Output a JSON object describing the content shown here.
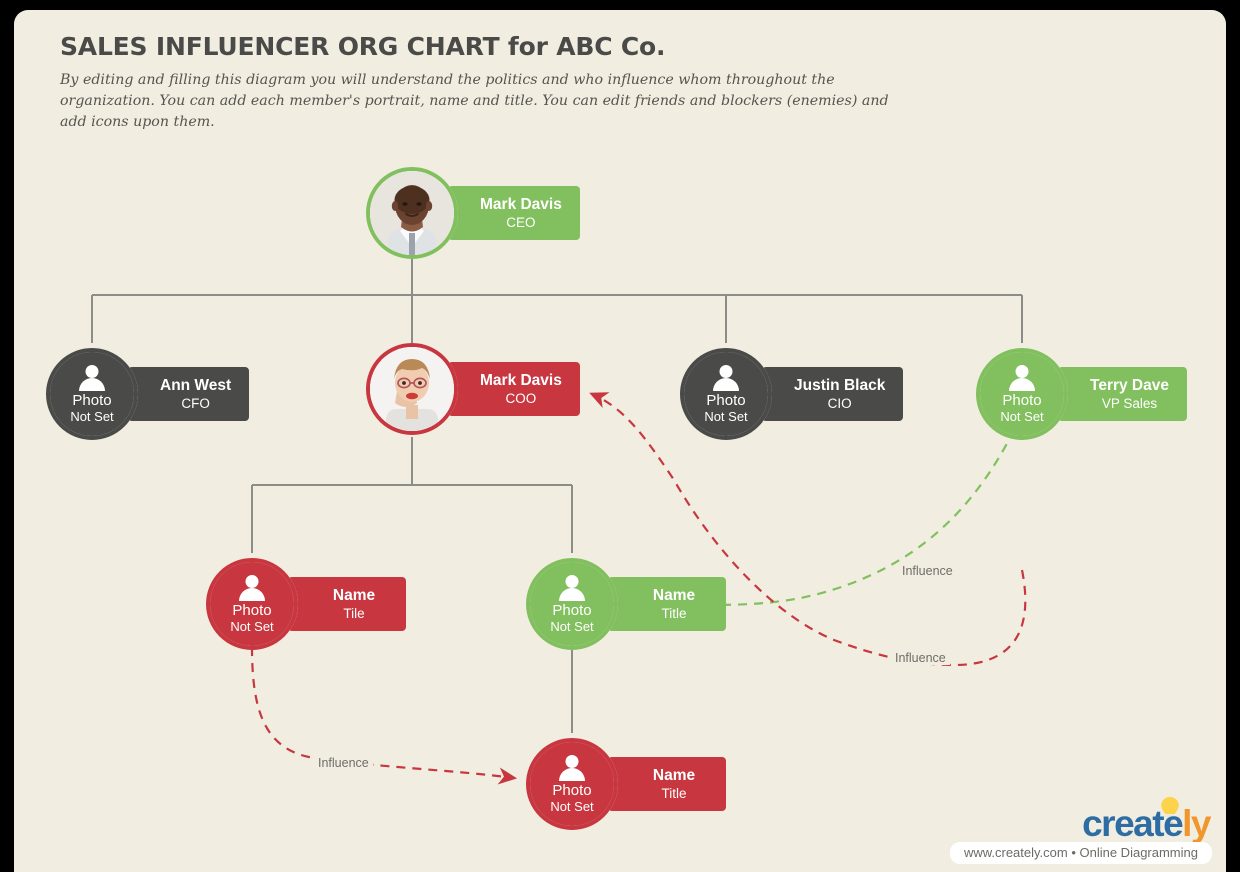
{
  "header": {
    "title": "SALES INFLUENCER ORG CHART for ABC Co.",
    "subtitle": "By editing and filling this diagram you will understand the politics and who influence whom throughout the organization. You can add each member's portrait, name and title. You can edit friends and blockers (enemies) and add icons upon them."
  },
  "photo_placeholder": {
    "line1": "Photo",
    "line2": "Not Set",
    "icon": "person-silhouette-icon"
  },
  "nodes": [
    {
      "id": "ceo",
      "name": "Mark Davis",
      "title": "CEO",
      "color": "green",
      "has_photo": true,
      "photo": "portrait-man"
    },
    {
      "id": "cfo",
      "name": "Ann West",
      "title": "CFO",
      "color": "gray",
      "has_photo": false
    },
    {
      "id": "coo",
      "name": "Mark Davis",
      "title": "COO",
      "color": "red",
      "has_photo": true,
      "photo": "portrait-woman"
    },
    {
      "id": "cio",
      "name": "Justin Black",
      "title": "CIO",
      "color": "gray",
      "has_photo": false
    },
    {
      "id": "vpsales",
      "name": "Terry Dave",
      "title": "VP Sales",
      "color": "green",
      "has_photo": false
    },
    {
      "id": "sub-left",
      "name": "Name",
      "title": "Tile",
      "color": "red",
      "has_photo": false
    },
    {
      "id": "sub-mid",
      "name": "Name",
      "title": "Title",
      "color": "green",
      "has_photo": false
    },
    {
      "id": "sub-bottom",
      "name": "Name",
      "title": "Title",
      "color": "red",
      "has_photo": false
    }
  ],
  "influence_labels": [
    {
      "id": "influence-green",
      "text": "Influence"
    },
    {
      "id": "influence-red-right",
      "text": "Influence"
    },
    {
      "id": "influence-red-bottom",
      "text": "Influence"
    }
  ],
  "logo": {
    "word_part1": "create",
    "word_part2": "ly",
    "tagline": "www.creately.com • Online Diagramming",
    "bulb_icon": "lightbulb-icon"
  },
  "colors": {
    "background": "#f1eee1",
    "green": "#82bf5e",
    "red": "#c8373f",
    "gray": "#4a4a48",
    "connector": "#8c8c88",
    "text_dark": "#4a4a48"
  }
}
